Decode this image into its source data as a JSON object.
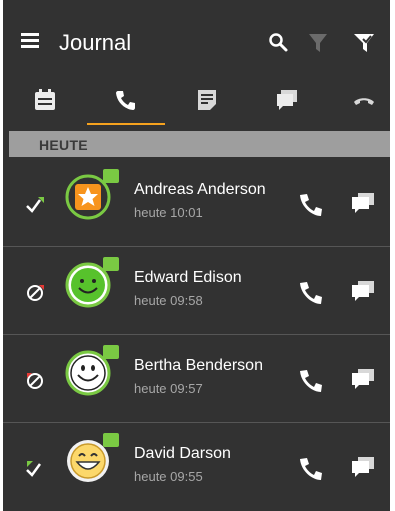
{
  "app": {
    "title": "Journal"
  },
  "colors": {
    "background": "#323232",
    "accent": "#f6a21e",
    "section": "#9e9e9e",
    "online": "#7ac943"
  },
  "header": {
    "icons": [
      "menu-icon",
      "search-icon",
      "filter-off-icon",
      "filter-on-icon"
    ]
  },
  "tabs": [
    {
      "icon": "calendar-icon",
      "active": false
    },
    {
      "icon": "phone-icon",
      "active": true
    },
    {
      "icon": "notes-icon",
      "active": false
    },
    {
      "icon": "chat-icon",
      "active": false
    },
    {
      "icon": "hangup-icon",
      "active": false
    }
  ],
  "section": {
    "label": "HEUTE"
  },
  "entries": [
    {
      "name": "Andreas Anderson",
      "time": "heute 10:01",
      "status": "outgoing-answered",
      "avatar": "star-avatar"
    },
    {
      "name": "Edward Edison",
      "time": "heute 09:58",
      "status": "outgoing-missed",
      "avatar": "smiley-green-avatar"
    },
    {
      "name": "Bertha Benderson",
      "time": "heute 09:57",
      "status": "incoming-missed",
      "avatar": "smiley-white-avatar"
    },
    {
      "name": "David Darson",
      "time": "heute 09:55",
      "status": "incoming-answered",
      "avatar": "grin-avatar"
    }
  ]
}
